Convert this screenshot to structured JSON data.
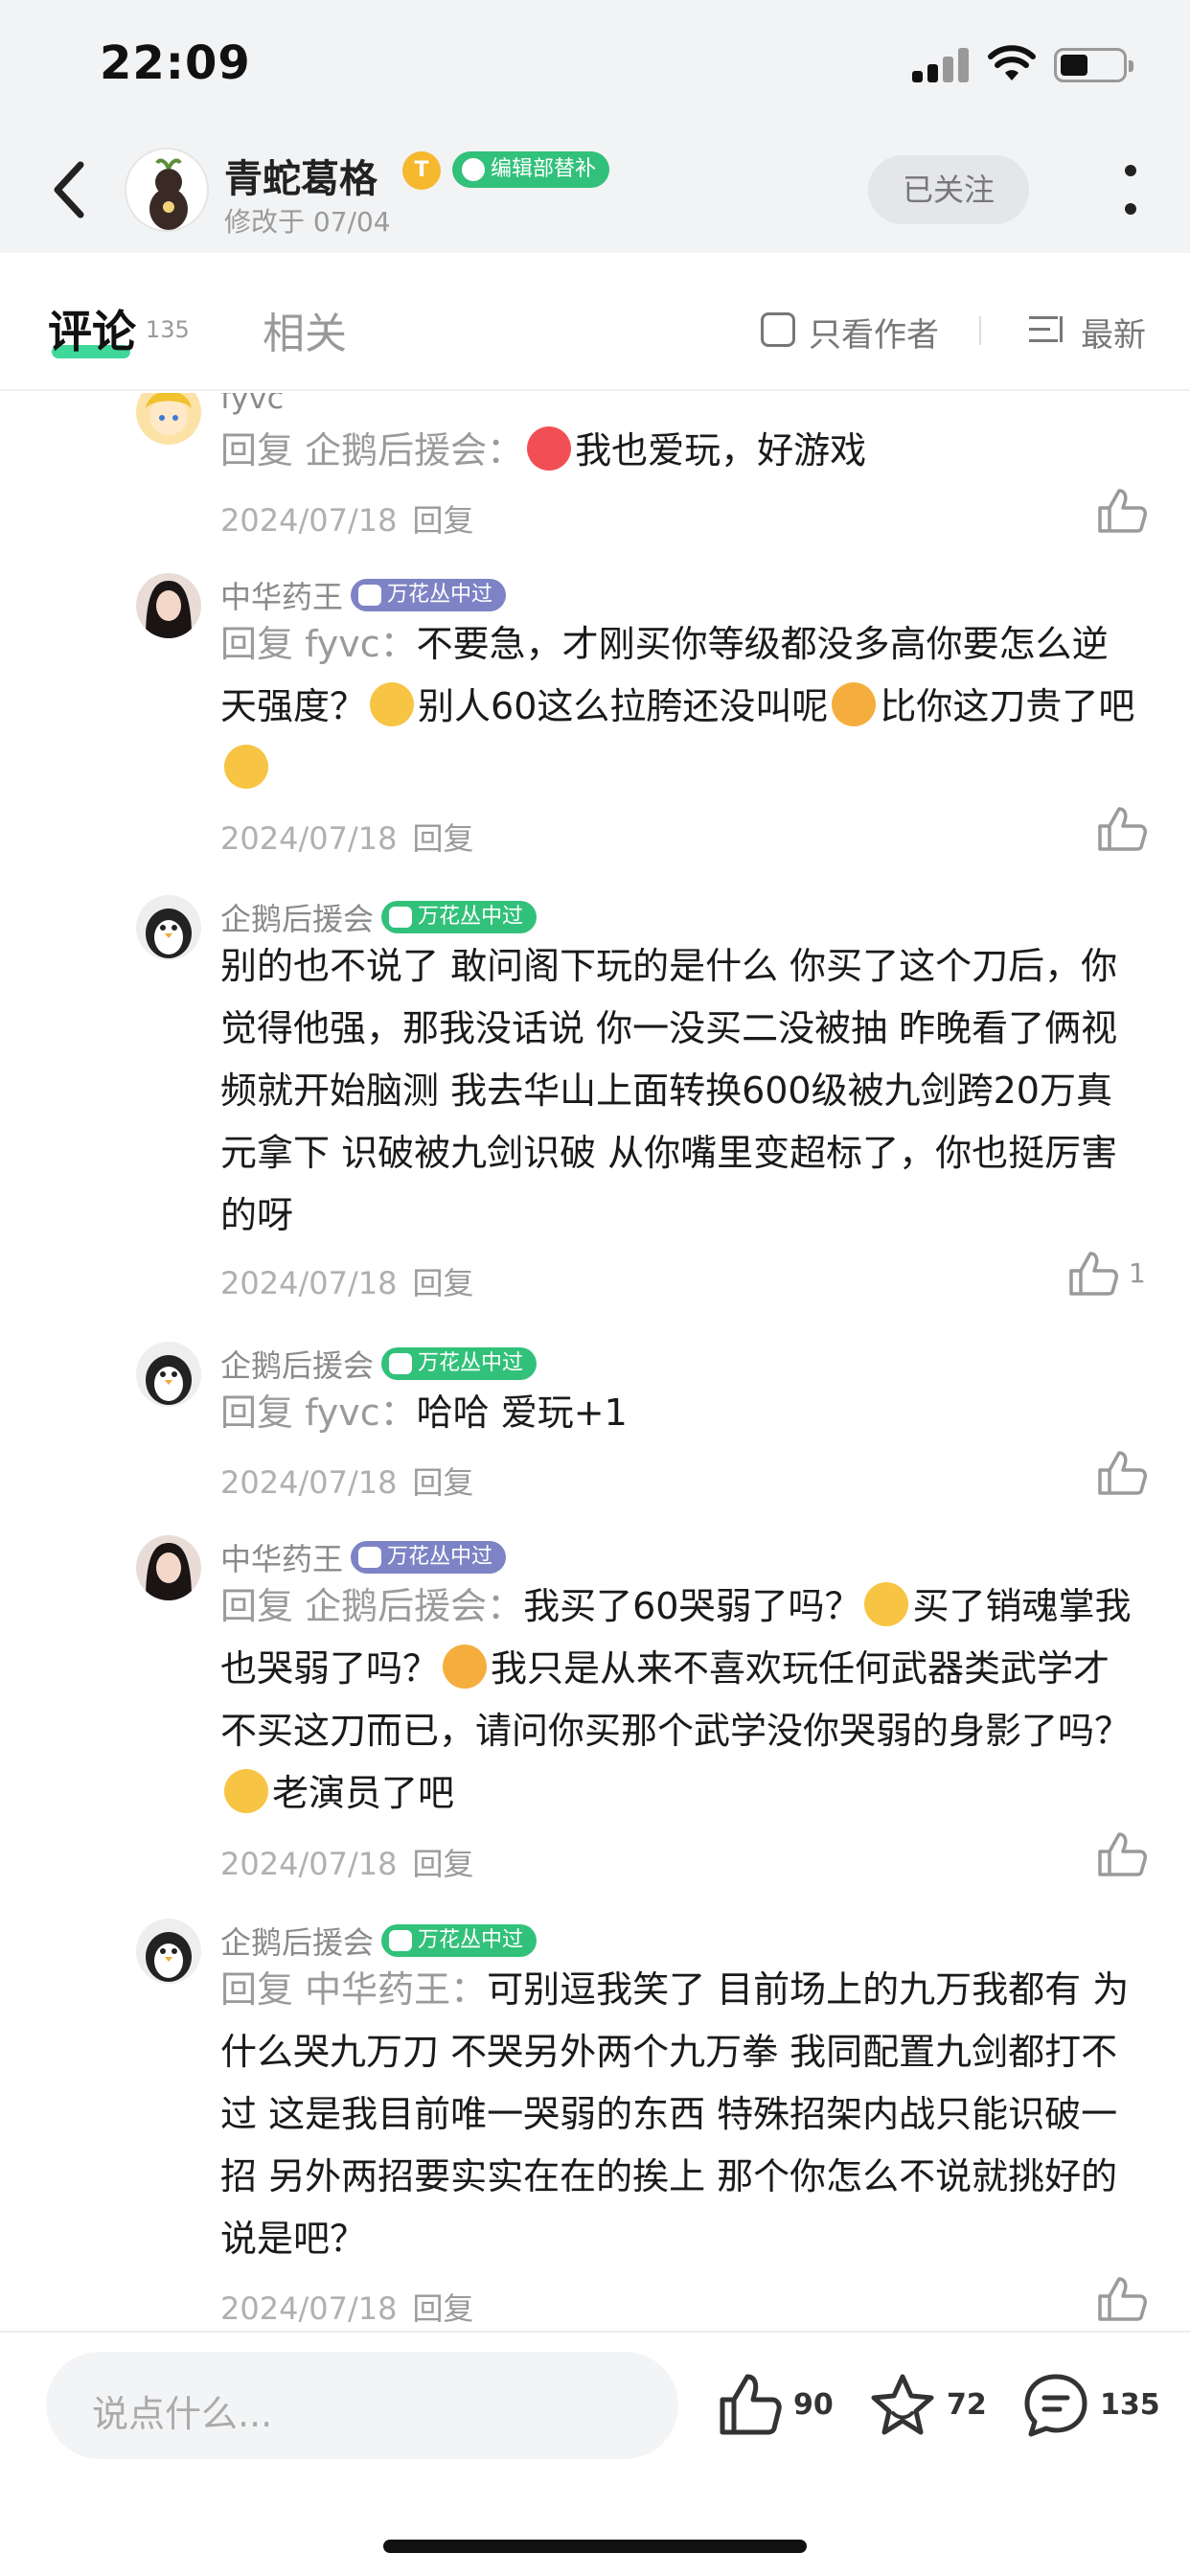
{
  "status_bar": {
    "time": "22:09"
  },
  "header": {
    "author_name": "青蛇葛格",
    "level_badge": "T",
    "role_badge": "编辑部替补",
    "modified": "修改于 07/04",
    "follow_label": "已关注"
  },
  "tabs": {
    "comments_label": "评论",
    "comments_count": "135",
    "related_label": "相关",
    "only_author_label": "只看作者",
    "sort_label": "最新"
  },
  "replies": [
    {
      "name": "fyvc",
      "badge": "",
      "prefix": "回复 企鹅后援会：",
      "segments": [
        "",
        "我也爱玩，好游戏"
      ],
      "date": "2024/07/18",
      "reply_label": "回复",
      "likes": ""
    },
    {
      "name": "中华药王",
      "badge": "万花丛中过",
      "prefix": "回复 fyvc：",
      "segments": [
        "不要急，才刚买你等级都没多高你要怎么逆天强度？",
        "别人60这么拉胯还没叫呢",
        "比你这刀贵了吧",
        ""
      ],
      "date": "2024/07/18",
      "reply_label": "回复",
      "likes": ""
    },
    {
      "name": "企鹅后援会",
      "badge": "万花丛中过",
      "prefix": "",
      "segments": [
        "别的也不说了 敢问阁下玩的是什么 你买了这个刀后，你觉得他强，那我没话说 你一没买二没被抽 昨晚看了俩视频就开始脑测 我去华山上面转换600级被九剑跨20万真元拿下 识破被九剑识破 从你嘴里变超标了，你也挺厉害的呀"
      ],
      "date": "2024/07/18",
      "reply_label": "回复",
      "likes": "1"
    },
    {
      "name": "企鹅后援会",
      "badge": "万花丛中过",
      "prefix": "回复 fyvc：",
      "segments": [
        "哈哈 爱玩+1"
      ],
      "date": "2024/07/18",
      "reply_label": "回复",
      "likes": ""
    },
    {
      "name": "中华药王",
      "badge": "万花丛中过",
      "prefix": "回复 企鹅后援会：",
      "segments": [
        "我买了60哭弱了吗？",
        "买了销魂掌我也哭弱了吗？",
        "我只是从来不喜欢玩任何武器类武学才不买这刀而已，请问你买那个武学没你哭弱的身影了吗？",
        "老演员了吧"
      ],
      "date": "2024/07/18",
      "reply_label": "回复",
      "likes": ""
    },
    {
      "name": "企鹅后援会",
      "badge": "万花丛中过",
      "prefix": "回复 中华药王：",
      "segments": [
        "可别逗我笑了 目前场上的九万我都有 为什么哭九万刀 不哭另外两个九万拳 我同配置九剑都打不过 这是我目前唯一哭弱的东西 特殊招架内战只能识破一招 另外两招要实实在在的挨上 那个你怎么不说就挑好的说是吧？"
      ],
      "date": "2024/07/18",
      "reply_label": "回复",
      "likes": ""
    }
  ],
  "bottom_bar": {
    "input_placeholder": "说点什么...",
    "like_count": "90",
    "star_count": "72",
    "comment_count": "135"
  },
  "colors": {
    "accent_green": "#32c17a",
    "tab_underline": "#40d79a",
    "badge_purple": "#7d83c4",
    "gold": "#f5b82e"
  }
}
